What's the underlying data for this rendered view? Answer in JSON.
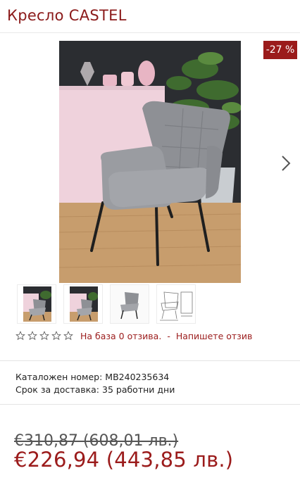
{
  "product": {
    "title": "Кресло CASTEL",
    "discount_badge": "-27 %",
    "main_image": "gray-armchair-photo",
    "thumbnails": [
      "chair-photo-1",
      "chair-photo-2",
      "chair-studio-photo",
      "chair-dimensions-drawing"
    ]
  },
  "rating": {
    "stars": 0,
    "max_stars": 5,
    "based_on": "На база 0 отзива.",
    "separator": "-",
    "write_review": "Напишете отзив"
  },
  "info": {
    "catalog_label": "Каталожен номер:",
    "catalog_value": "MB240235634",
    "delivery_label": "Срок за доставка:",
    "delivery_value": "35 работни дни"
  },
  "price": {
    "old": "€310,87 (608,01 лв.)",
    "new": "€226,94 (443,85 лв.)"
  },
  "colors": {
    "accent": "#9b1b1b",
    "title": "#8b1a1a"
  }
}
